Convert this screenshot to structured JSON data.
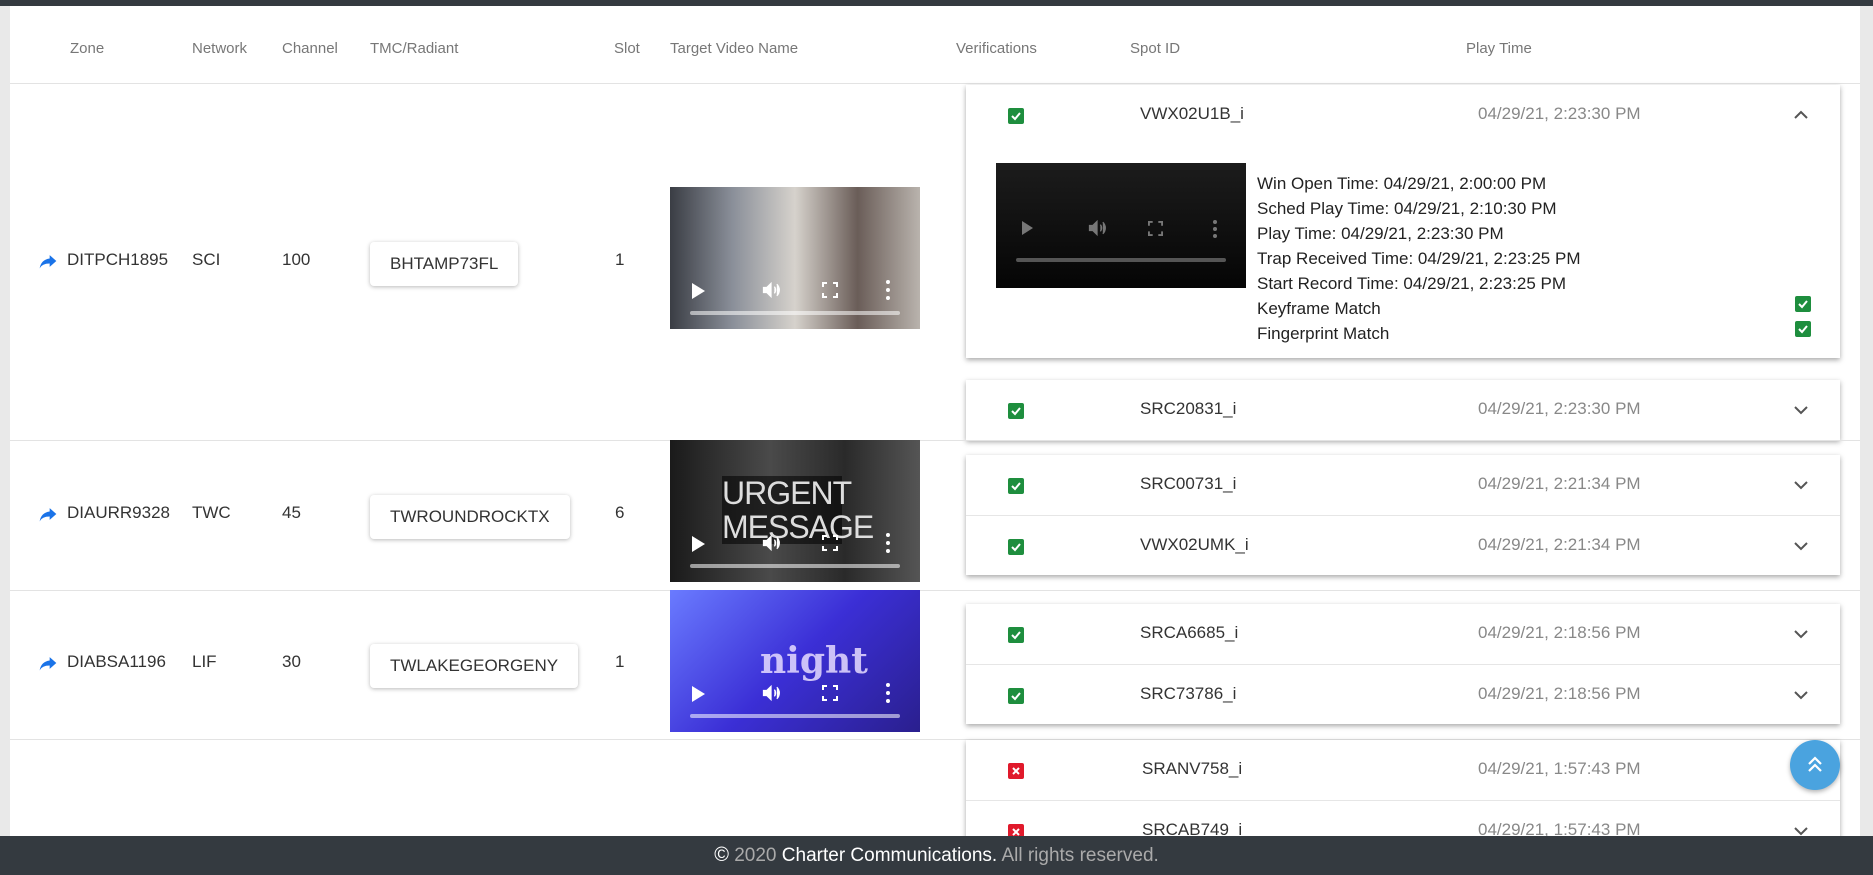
{
  "columns": [
    "Zone",
    "Network",
    "Channel",
    "TMC/Radiant",
    "Slot",
    "Target Video Name",
    "Verifications",
    "Spot ID",
    "Play Time"
  ],
  "rows": [
    {
      "zone": "DITPCH1895",
      "network": "SCI",
      "channel": "100",
      "tmc": "BHTAMP73FL",
      "slot": "1",
      "spots": [
        {
          "spot_id": "VWX02U1B_i",
          "play_time": "04/29/21, 2:23:30 PM",
          "verified": true,
          "expanded": true,
          "details": {
            "win_open": "Win Open Time: 04/29/21, 2:00:00 PM",
            "sched_play": "Sched Play Time: 04/29/21, 2:10:30 PM",
            "play": "Play Time: 04/29/21, 2:23:30 PM",
            "trap_received": "Trap Received Time: 04/29/21, 2:23:25 PM",
            "start_record": "Start Record Time: 04/29/21, 2:23:25 PM",
            "keyframe": "Keyframe Match",
            "fingerprint": "Fingerprint Match"
          }
        },
        {
          "spot_id": "SRC20831_i",
          "play_time": "04/29/21, 2:23:30 PM",
          "verified": true
        }
      ]
    },
    {
      "zone": "DIAURR9328",
      "network": "TWC",
      "channel": "45",
      "tmc": "TWROUNDROCKTX",
      "slot": "6",
      "video_text": [
        "URGENT",
        "MESSAGE"
      ],
      "spots": [
        {
          "spot_id": "SRC00731_i",
          "play_time": "04/29/21, 2:21:34 PM",
          "verified": true
        },
        {
          "spot_id": "VWX02UMK_i",
          "play_time": "04/29/21, 2:21:34 PM",
          "verified": true
        }
      ]
    },
    {
      "zone": "DIABSA1196",
      "network": "LIF",
      "channel": "30",
      "tmc": "TWLAKEGEORGENY",
      "slot": "1",
      "video_text": [
        "night"
      ],
      "spots": [
        {
          "spot_id": "SRCA6685_i",
          "play_time": "04/29/21, 2:18:56 PM",
          "verified": true
        },
        {
          "spot_id": "SRC73786_i",
          "play_time": "04/29/21, 2:18:56 PM",
          "verified": true
        }
      ]
    },
    {
      "spots": [
        {
          "spot_id": "SRANV758_i",
          "play_time": "04/29/21, 1:57:43 PM",
          "verified": false
        },
        {
          "spot_id": "SRCAB749_i",
          "play_time": "04/29/21, 1:57:43 PM",
          "verified": false
        }
      ]
    }
  ],
  "footer": {
    "copyright_symbol": "©",
    "year": "2020",
    "company": "Charter Communications.",
    "rights": "All rights reserved."
  },
  "icons": {
    "share": "share-icon",
    "play": "play-icon",
    "volume": "volume-icon",
    "fullscreen": "fullscreen-icon",
    "more": "more-vertical-icon",
    "check": "check-box-icon",
    "fail": "x-box-icon",
    "chevron_up": "chevron-up-icon",
    "chevron_down": "chevron-down-icon",
    "scroll_top": "double-chevron-up-icon"
  },
  "colors": {
    "check_green": "#1e8e3e",
    "fail_red": "#e0192b",
    "link_blue": "#1a73e8",
    "fab_blue": "#4aa3df",
    "footer_bg": "#343a40"
  }
}
